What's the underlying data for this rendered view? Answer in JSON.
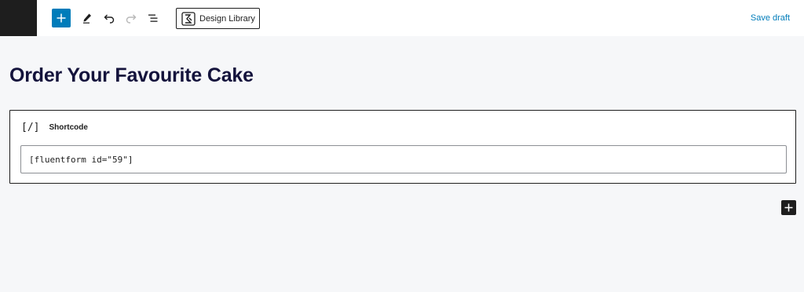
{
  "toolbar": {
    "inserter_icon": "plus-icon",
    "tools_icon": "pencil-icon",
    "undo_icon": "undo-icon",
    "redo_icon": "redo-icon",
    "list_view_icon": "list-view-icon",
    "design_library_label": "Design Library",
    "save_draft_label": "Save draft",
    "accent_color": "#007cba"
  },
  "content": {
    "title": "Order Your Favourite Cake",
    "title_color": "#14133c",
    "shortcode_block": {
      "icon_text": "[/]",
      "label": "Shortcode",
      "value": "[fluentform id=\"59\"]"
    },
    "appender_icon": "plus-icon"
  }
}
